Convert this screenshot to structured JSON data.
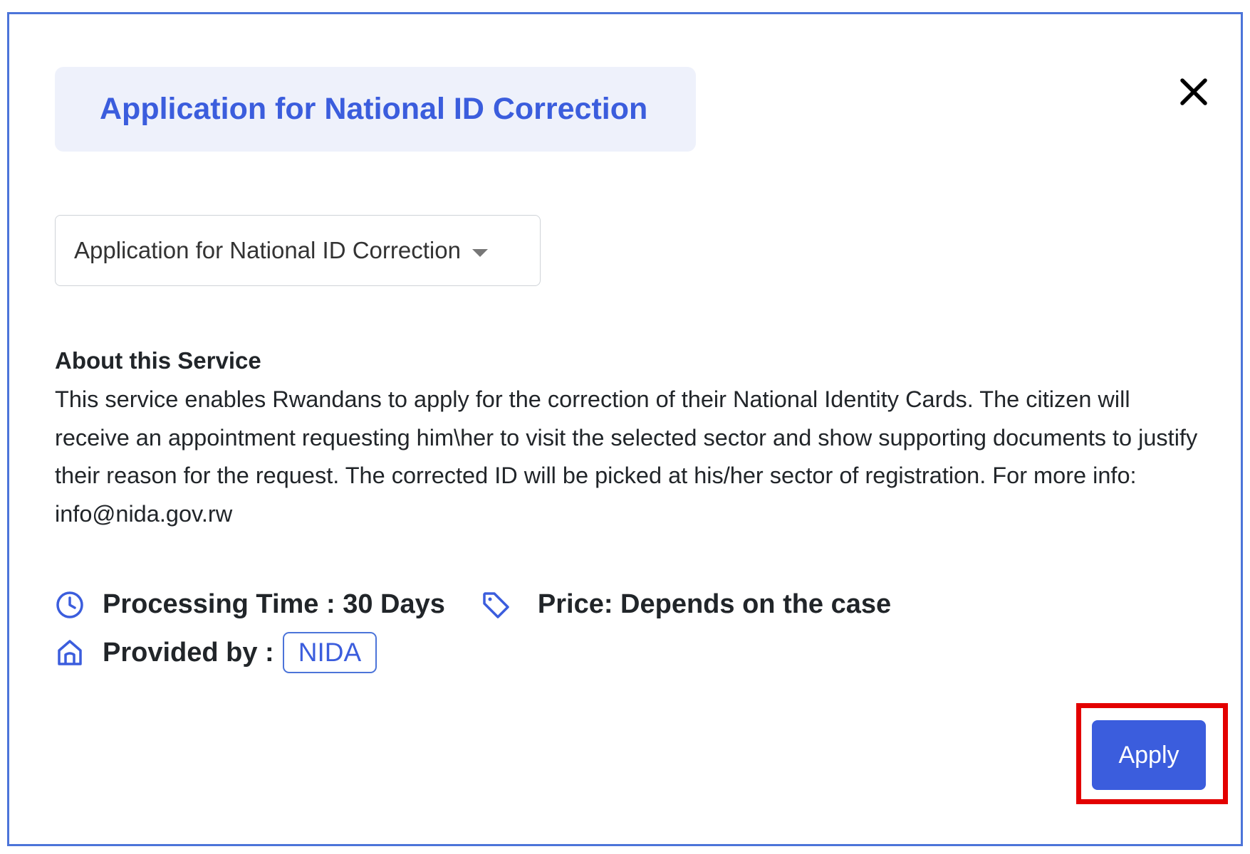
{
  "modal": {
    "title": "Application for National ID Correction",
    "close_icon": "close-icon"
  },
  "service_select": {
    "selected": "Application for National ID Correction",
    "icon": "chevron-down-icon"
  },
  "about": {
    "heading": "About this Service",
    "body": "This service enables Rwandans to apply for the correction of their National Identity Cards. The citizen will receive an appointment requesting him\\her to visit the selected sector and show supporting documents to justify their reason for the request. The corrected ID will be picked at his/her sector of registration. For more info: info@nida.gov.rw"
  },
  "details": {
    "processing_time": "Processing Time : 30 Days",
    "processing_icon": "clock-icon",
    "price": "Price: Depends on the case",
    "price_icon": "tag-icon",
    "provided_by_label": "Provided by :",
    "provider_icon": "home-icon",
    "provider": "NIDA"
  },
  "actions": {
    "apply_label": "Apply"
  },
  "colors": {
    "accent": "#3b5ddd",
    "highlight": "#e30000",
    "title_bg": "#eef1fb"
  }
}
